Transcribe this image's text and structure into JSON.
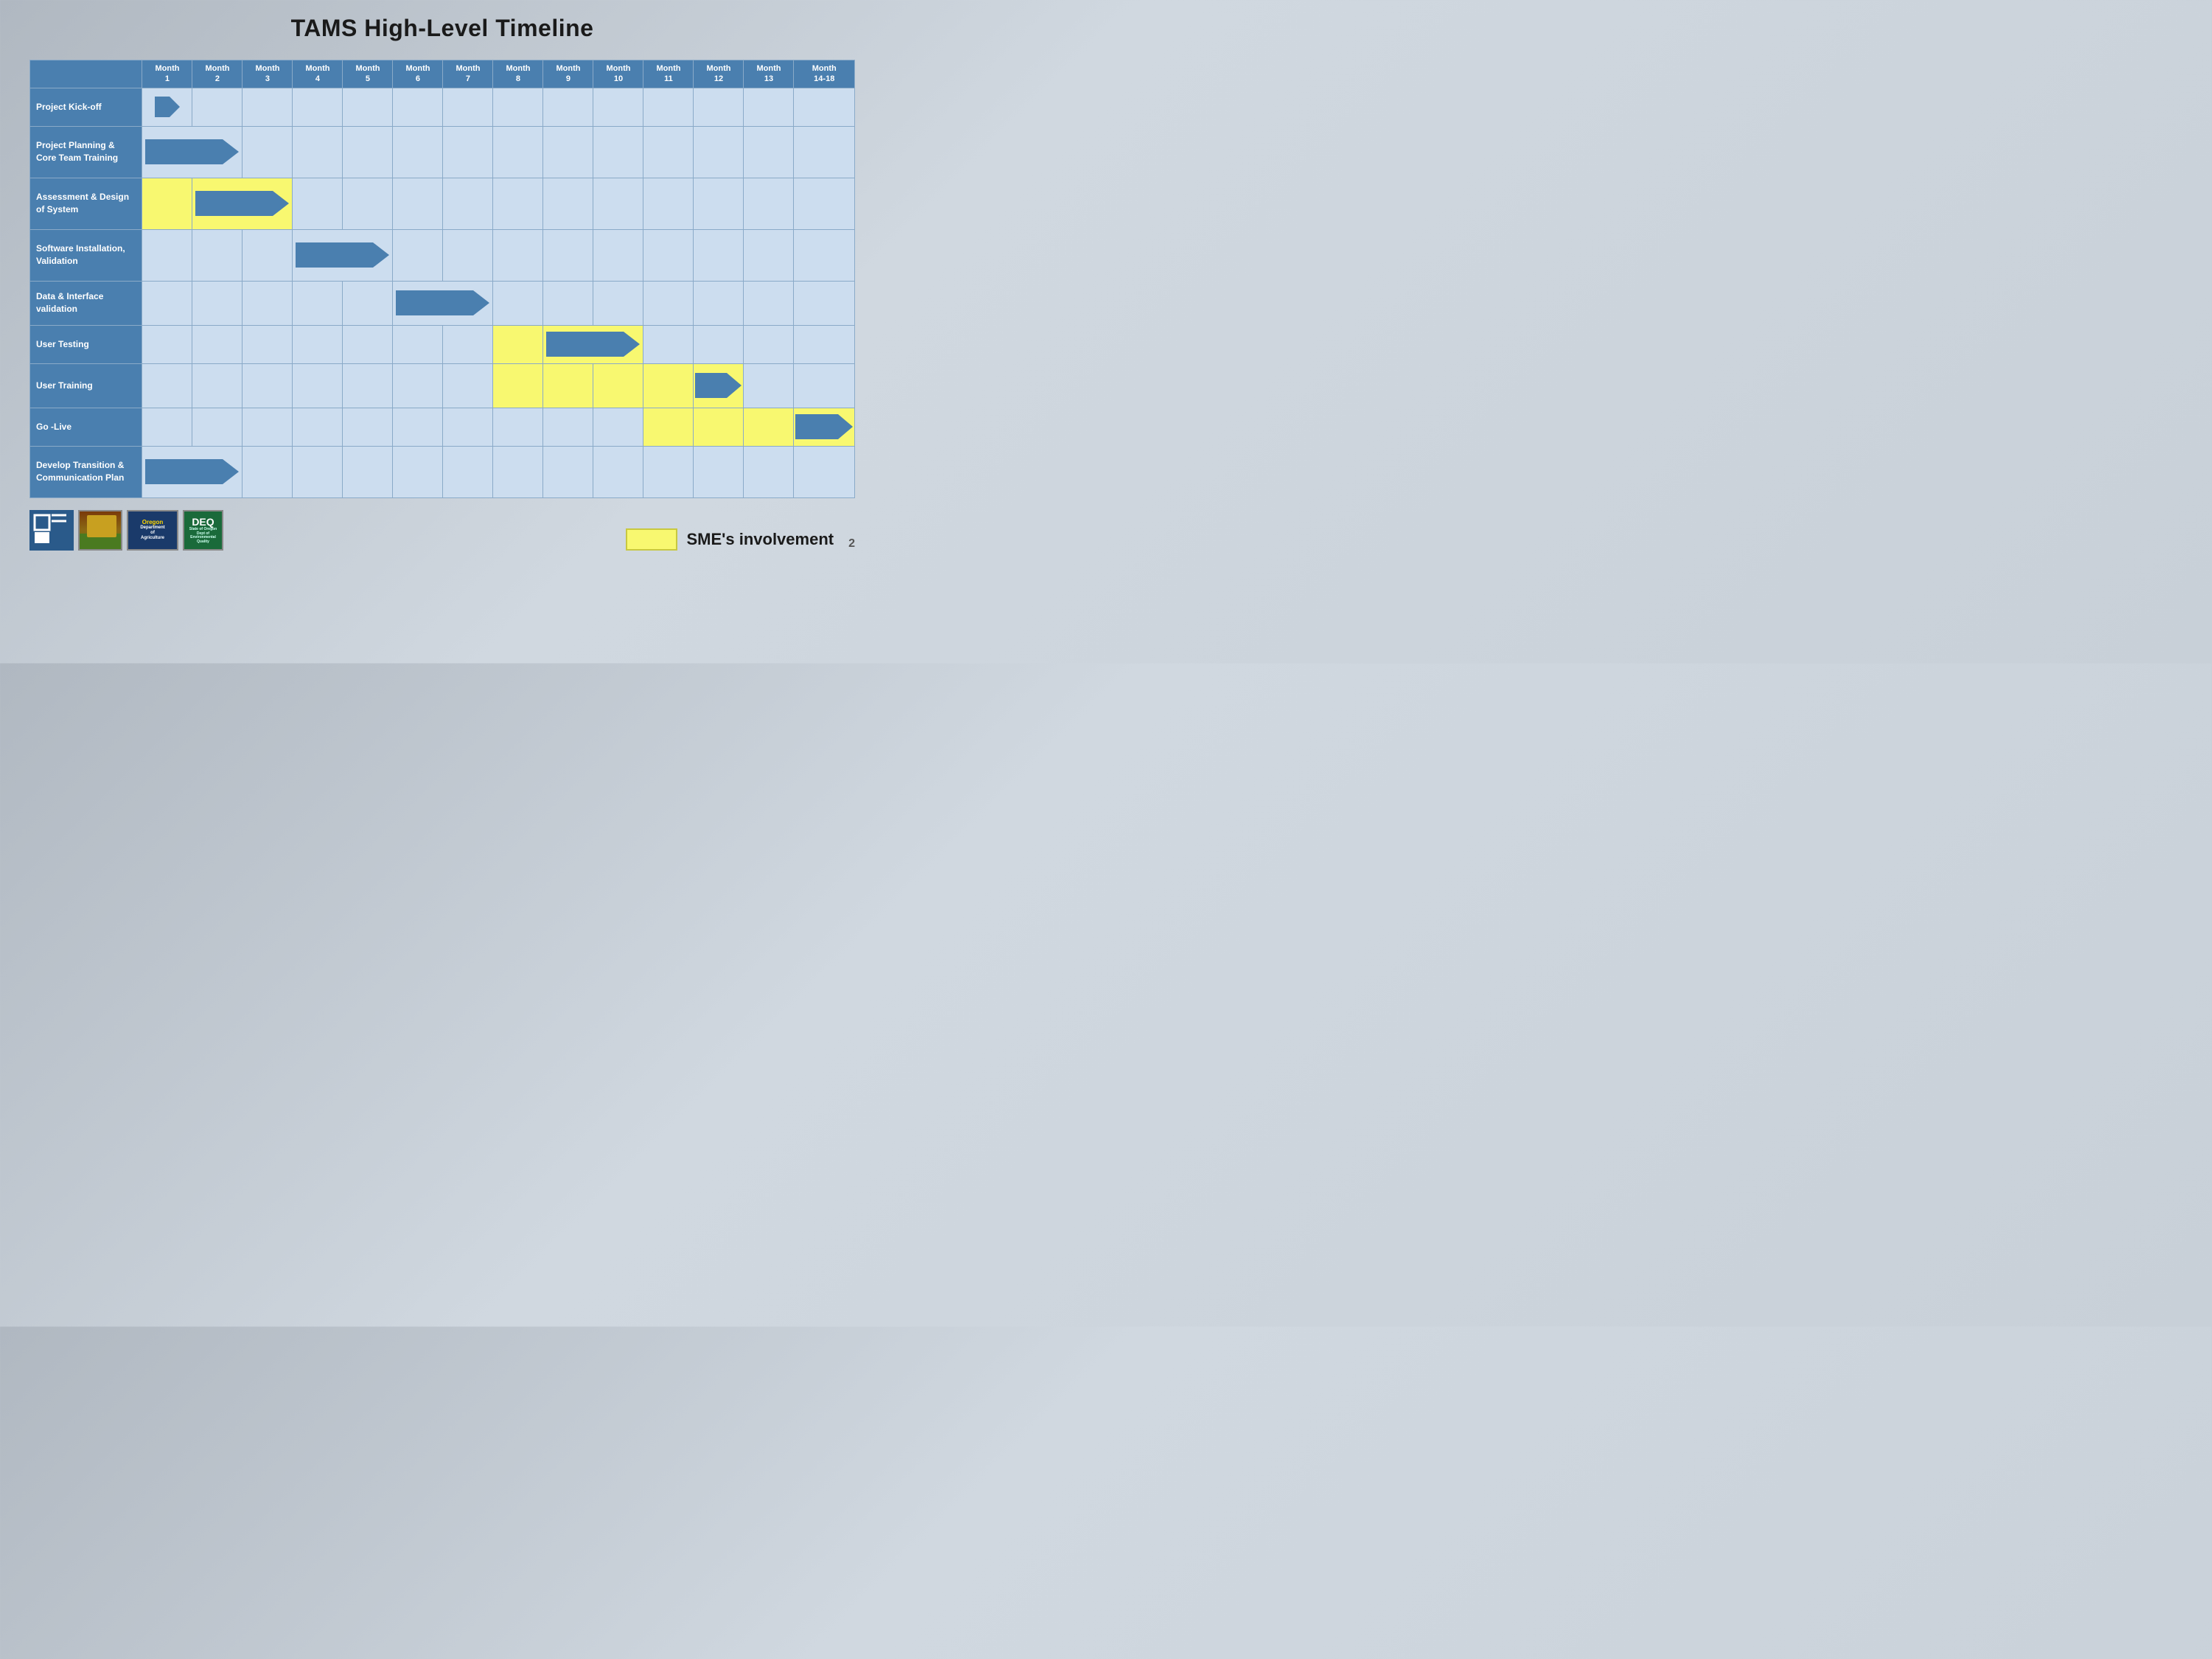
{
  "title": "TAMS High-Level Timeline",
  "header": {
    "months": [
      {
        "label": "Month",
        "num": "1"
      },
      {
        "label": "Month",
        "num": "2"
      },
      {
        "label": "Month",
        "num": "3"
      },
      {
        "label": "Month",
        "num": "4"
      },
      {
        "label": "Month",
        "num": "5"
      },
      {
        "label": "Month",
        "num": "6"
      },
      {
        "label": "Month",
        "num": "7"
      },
      {
        "label": "Month",
        "num": "8"
      },
      {
        "label": "Month",
        "num": "9"
      },
      {
        "label": "Month",
        "num": "10"
      },
      {
        "label": "Month",
        "num": "11"
      },
      {
        "label": "Month",
        "num": "12"
      },
      {
        "label": "Month",
        "num": "13"
      },
      {
        "label": "Month",
        "num": "14-18"
      }
    ]
  },
  "tasks": [
    {
      "id": "kickoff",
      "label": "Project Kick-off",
      "arrow_start": 1,
      "arrow_end": 1,
      "yellow_cols": []
    },
    {
      "id": "planning",
      "label": "Project Planning & Core Team Training",
      "arrow_start": 1,
      "arrow_end": 2,
      "yellow_cols": []
    },
    {
      "id": "assessment",
      "label": "Assessment & Design of System",
      "arrow_start": 1,
      "arrow_end": 3,
      "yellow_cols": [
        1,
        2,
        3
      ]
    },
    {
      "id": "software",
      "label": "Software Installation, Validation",
      "arrow_start": 4,
      "arrow_end": 5,
      "yellow_cols": []
    },
    {
      "id": "data",
      "label": "Data & Interface validation",
      "arrow_start": 6,
      "arrow_end": 7,
      "yellow_cols": []
    },
    {
      "id": "usertesting",
      "label": "User Testing",
      "arrow_start": 8,
      "arrow_end": 9,
      "yellow_cols": [
        8,
        9
      ]
    },
    {
      "id": "usertraining",
      "label": "User Training",
      "arrow_start": 8,
      "arrow_end": 12,
      "yellow_cols": [
        8,
        9,
        10,
        11,
        12
      ]
    },
    {
      "id": "golive",
      "label": "Go -Live",
      "arrow_start": 11,
      "arrow_end": 14,
      "yellow_cols": [
        11,
        12,
        13,
        14
      ]
    },
    {
      "id": "develop",
      "label": "Develop Transition & Communication Plan",
      "arrow_start": 1,
      "arrow_end": 2,
      "yellow_cols": []
    }
  ],
  "legend": {
    "label": "SME's involvement"
  },
  "page_number": "2"
}
